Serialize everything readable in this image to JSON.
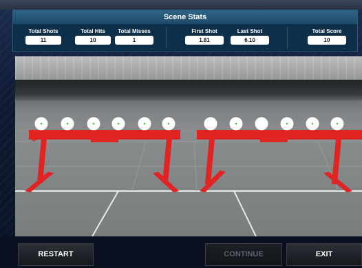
{
  "stats": {
    "title": "Scene Stats",
    "items": [
      {
        "label": "Total Shots",
        "value": "11"
      },
      {
        "label": "Total Hits",
        "value": "10"
      },
      {
        "label": "Total Misses",
        "value": "1"
      },
      {
        "label": "First Shot",
        "value": "1.81"
      },
      {
        "label": "Last Shot",
        "value": "6.10"
      },
      {
        "label": "Total Score",
        "value": "10"
      }
    ]
  },
  "scene": {
    "targets_total": 12,
    "targets_hit": 10,
    "stand_color": "#e02424",
    "target_color": "#ffffff"
  },
  "buttons": {
    "restart": "RESTART",
    "continue": "CONTINUE",
    "exit": "EXIT"
  }
}
